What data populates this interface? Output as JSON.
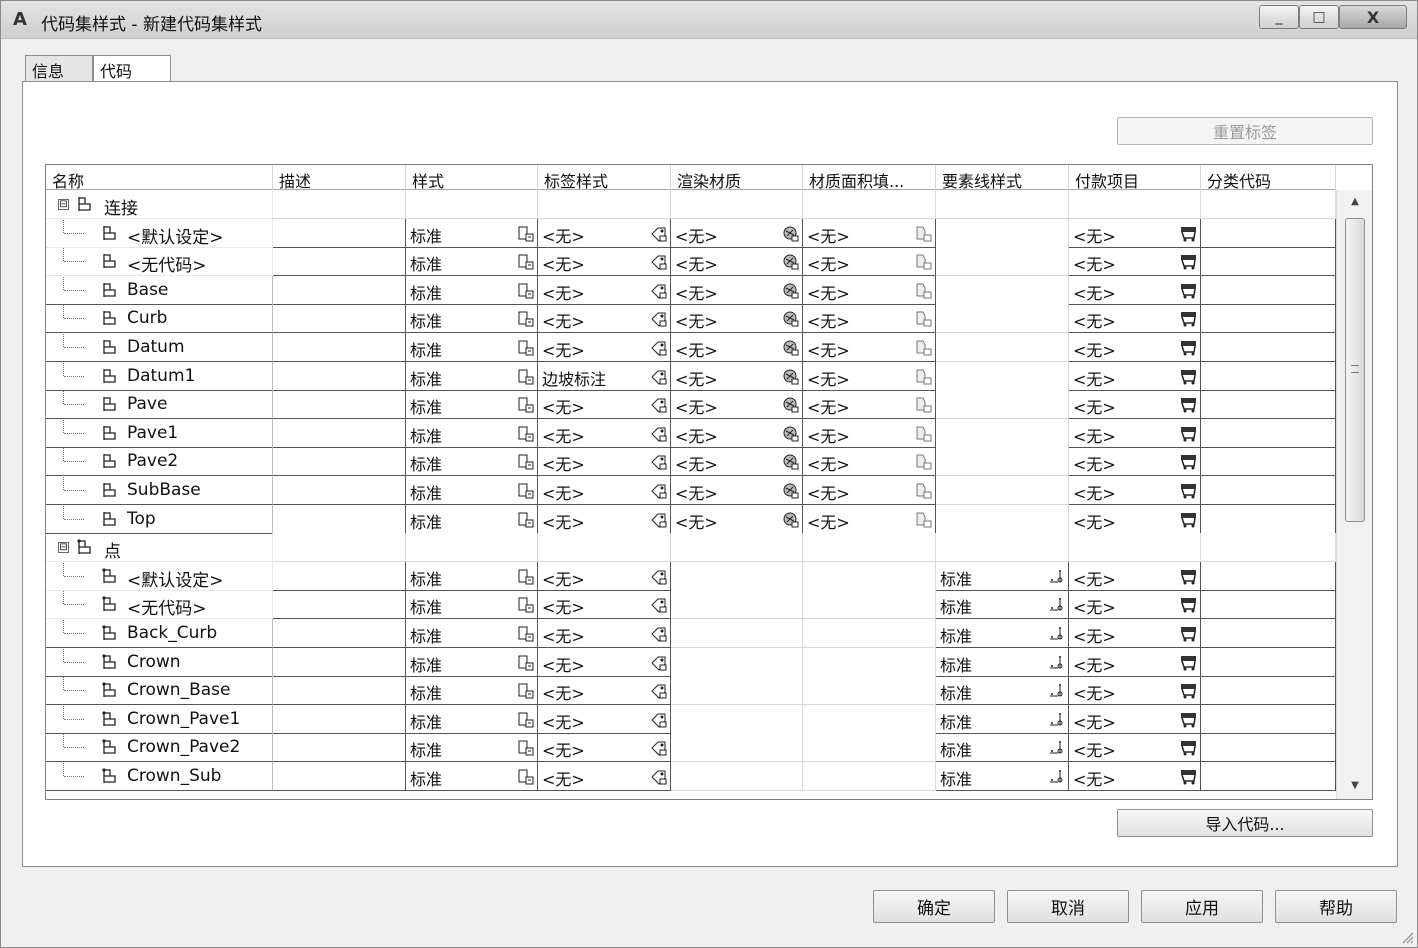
{
  "window": {
    "title": "代码集样式 - 新建代码集样式",
    "app_icon_glyph": "A",
    "close_glyph": "X",
    "max_glyph": "□",
    "min_glyph": "_"
  },
  "tabs": [
    {
      "label": "信息"
    },
    {
      "label": "代码",
      "selected": true
    }
  ],
  "reset_button": {
    "label": "重置标签",
    "enabled": false
  },
  "table": {
    "columns": [
      "名称",
      "描述",
      "样式",
      "标签样式",
      "渲染材质",
      "材质面积填...",
      "要素线样式",
      "付款项目",
      "分类代码"
    ],
    "groups": [
      {
        "label": "连接",
        "expander": "⊟",
        "rows": [
          {
            "name": "<默认设定>",
            "style": "标准",
            "label_style": "<无>",
            "render": "<无>",
            "area_fill": "<无>",
            "feature_line": "",
            "pay_item": "<无>"
          },
          {
            "name": "<无代码>",
            "style": "标准",
            "label_style": "<无>",
            "render": "<无>",
            "area_fill": "<无>",
            "feature_line": "",
            "pay_item": "<无>"
          },
          {
            "name": "Base",
            "style": "标准",
            "label_style": "<无>",
            "render": "<无>",
            "area_fill": "<无>",
            "feature_line": "",
            "pay_item": "<无>"
          },
          {
            "name": "Curb",
            "style": "标准",
            "label_style": "<无>",
            "render": "<无>",
            "area_fill": "<无>",
            "feature_line": "",
            "pay_item": "<无>"
          },
          {
            "name": "Datum",
            "style": "标准",
            "label_style": "<无>",
            "render": "<无>",
            "area_fill": "<无>",
            "feature_line": "",
            "pay_item": "<无>"
          },
          {
            "name": "Datum1",
            "style": "标准",
            "label_style": "边坡标注",
            "render": "<无>",
            "area_fill": "<无>",
            "feature_line": "",
            "pay_item": "<无>"
          },
          {
            "name": "Pave",
            "style": "标准",
            "label_style": "<无>",
            "render": "<无>",
            "area_fill": "<无>",
            "feature_line": "",
            "pay_item": "<无>"
          },
          {
            "name": "Pave1",
            "style": "标准",
            "label_style": "<无>",
            "render": "<无>",
            "area_fill": "<无>",
            "feature_line": "",
            "pay_item": "<无>"
          },
          {
            "name": "Pave2",
            "style": "标准",
            "label_style": "<无>",
            "render": "<无>",
            "area_fill": "<无>",
            "feature_line": "",
            "pay_item": "<无>"
          },
          {
            "name": "SubBase",
            "style": "标准",
            "label_style": "<无>",
            "render": "<无>",
            "area_fill": "<无>",
            "feature_line": "",
            "pay_item": "<无>"
          },
          {
            "name": "Top",
            "style": "标准",
            "label_style": "<无>",
            "render": "<无>",
            "area_fill": "<无>",
            "feature_line": "",
            "pay_item": "<无>"
          }
        ]
      },
      {
        "label": "点",
        "expander": "⊟",
        "rows": [
          {
            "name": "<默认设定>",
            "style": "标准",
            "label_style": "<无>",
            "feature_line": "标准",
            "pay_item": "<无>"
          },
          {
            "name": "<无代码>",
            "style": "标准",
            "label_style": "<无>",
            "feature_line": "标准",
            "pay_item": "<无>"
          },
          {
            "name": "Back_Curb",
            "style": "标准",
            "label_style": "<无>",
            "feature_line": "标准",
            "pay_item": "<无>"
          },
          {
            "name": "Crown",
            "style": "标准",
            "label_style": "<无>",
            "feature_line": "标准",
            "pay_item": "<无>"
          },
          {
            "name": "Crown_Base",
            "style": "标准",
            "label_style": "<无>",
            "feature_line": "标准",
            "pay_item": "<无>"
          },
          {
            "name": "Crown_Pave1",
            "style": "标准",
            "label_style": "<无>",
            "feature_line": "标准",
            "pay_item": "<无>"
          },
          {
            "name": "Crown_Pave2",
            "style": "标准",
            "label_style": "<无>",
            "feature_line": "标准",
            "pay_item": "<无>"
          },
          {
            "name": "Crown_Sub",
            "style": "标准",
            "label_style": "<无>",
            "feature_line": "标准",
            "pay_item": "<无>"
          }
        ]
      }
    ]
  },
  "import_button": {
    "label": "导入代码..."
  },
  "footer": {
    "ok": "确定",
    "cancel": "取消",
    "apply": "应用",
    "help": "帮助"
  },
  "scrollbar": {
    "up_glyph": "▲",
    "down_glyph": "▼"
  }
}
